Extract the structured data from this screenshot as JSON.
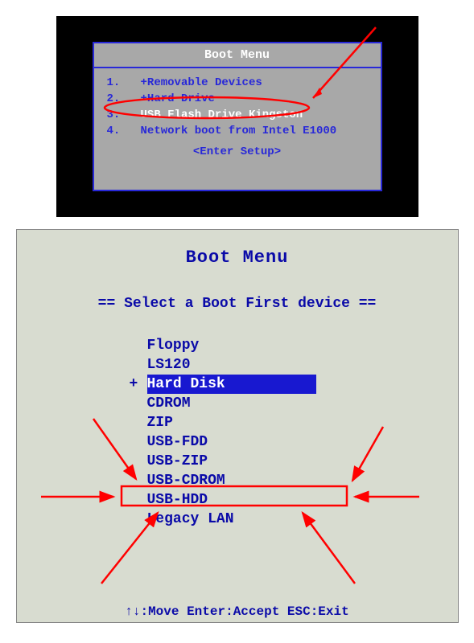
{
  "panel1": {
    "title": "Boot Menu",
    "items": [
      {
        "num": "1.",
        "label": "+Removable Devices"
      },
      {
        "num": "2.",
        "label": "+Hard Drive"
      },
      {
        "num": "3.",
        "label": "USB Flash Drive Kingston",
        "selected": true
      },
      {
        "num": "4.",
        "label": "Network boot from Intel E1000"
      }
    ],
    "footer": "<Enter Setup>"
  },
  "panel2": {
    "title": "Boot Menu",
    "subtitle": "== Select a Boot First device ==",
    "items": [
      {
        "label": "Floppy"
      },
      {
        "label": "LS120"
      },
      {
        "label": "Hard Disk",
        "selected": true,
        "plus": "+"
      },
      {
        "label": "CDROM"
      },
      {
        "label": "ZIP"
      },
      {
        "label": "USB-FDD"
      },
      {
        "label": "USB-ZIP"
      },
      {
        "label": "USB-CDROM"
      },
      {
        "label": "USB-HDD",
        "boxed": true
      },
      {
        "label": "Legacy LAN"
      }
    ],
    "footer": "↑↓:Move Enter:Accept ESC:Exit"
  }
}
